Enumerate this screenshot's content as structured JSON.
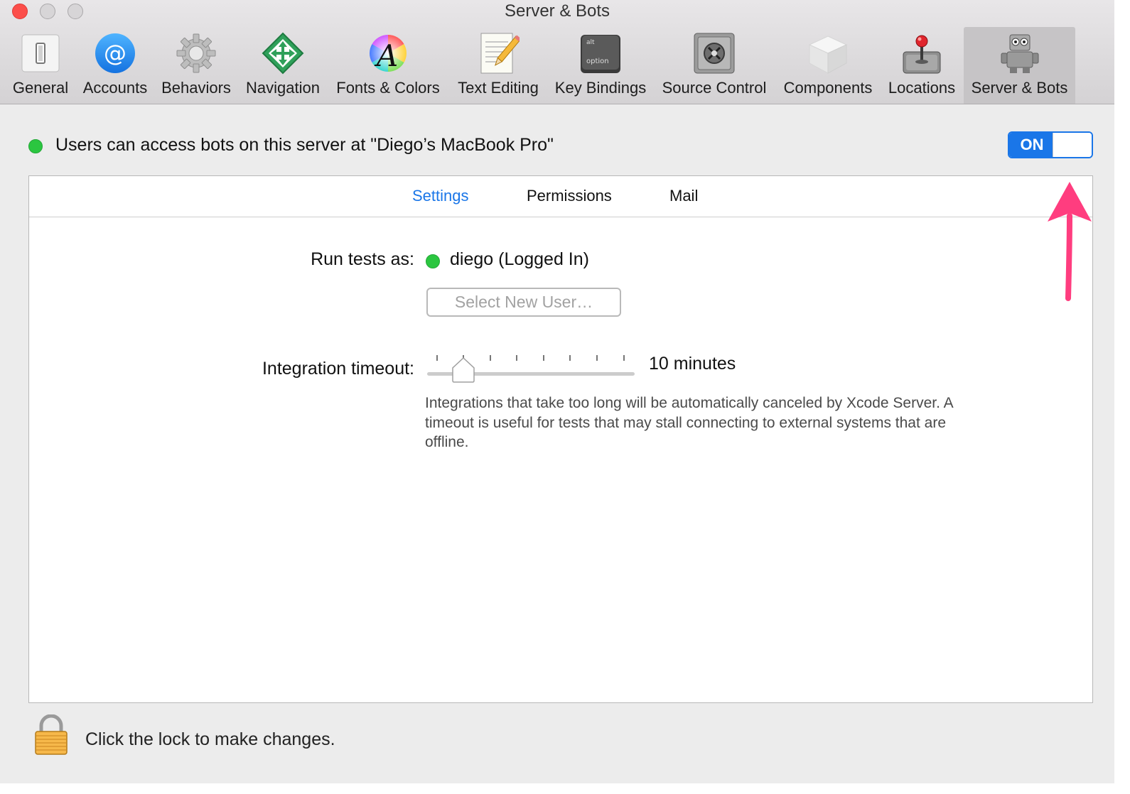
{
  "window": {
    "title": "Server & Bots"
  },
  "toolbar": {
    "items": [
      {
        "label": "General",
        "icon": "general-switch-icon"
      },
      {
        "label": "Accounts",
        "icon": "at-sign-icon"
      },
      {
        "label": "Behaviors",
        "icon": "gear-icon"
      },
      {
        "label": "Navigation",
        "icon": "navigation-arrows-icon"
      },
      {
        "label": "Fonts & Colors",
        "icon": "font-color-wheel-icon"
      },
      {
        "label": "Text Editing",
        "icon": "notepad-pencil-icon"
      },
      {
        "label": "Key Bindings",
        "icon": "option-key-icon"
      },
      {
        "label": "Source Control",
        "icon": "vault-icon"
      },
      {
        "label": "Components",
        "icon": "component-box-icon"
      },
      {
        "label": "Locations",
        "icon": "joystick-drive-icon"
      },
      {
        "label": "Server & Bots",
        "icon": "robot-icon"
      }
    ],
    "selected": "Server & Bots",
    "option_key_alt": "alt",
    "option_key_option": "option"
  },
  "server": {
    "status_text": "Users can access bots on this server at \"Diego’s MacBook Pro\"",
    "switch_label": "ON",
    "switch_on": true,
    "status_color": "#2bc640"
  },
  "tabs": [
    {
      "label": "Settings",
      "active": true
    },
    {
      "label": "Permissions",
      "active": false
    },
    {
      "label": "Mail",
      "active": false
    }
  ],
  "settings": {
    "run_tests_label": "Run tests as:",
    "user": "diego (Logged In)",
    "select_user_button": "Select New User…",
    "timeout_label": "Integration timeout:",
    "timeout_value": "10 minutes",
    "timeout_slider_position": 1,
    "timeout_slider_steps": 8,
    "help_text": "Integrations that take too long will be automatically canceled by Xcode Server.  A timeout is useful for tests that may stall connecting to external systems that are offline."
  },
  "footer": {
    "lock_text": "Click the lock to make changes."
  },
  "colors": {
    "accent": "#1a76e8",
    "annotation_arrow": "#ff3d7f"
  }
}
